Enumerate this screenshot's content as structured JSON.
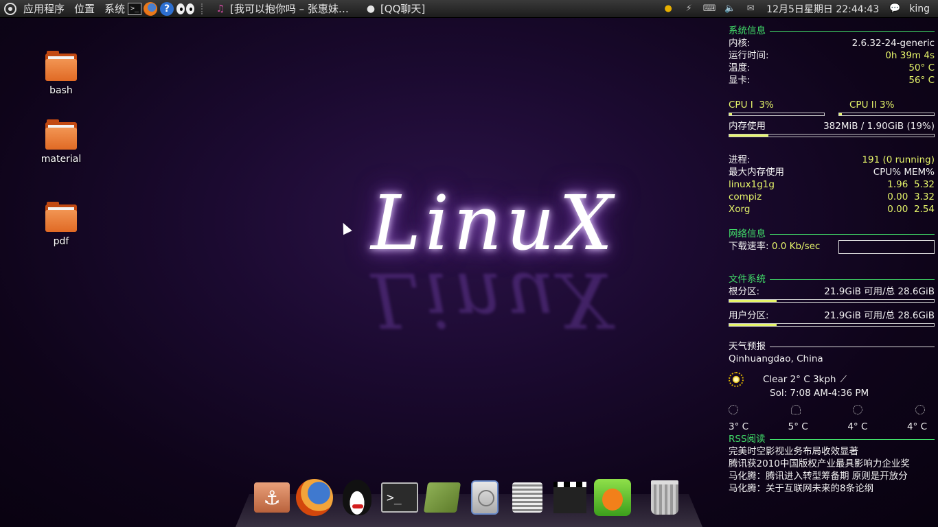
{
  "panel": {
    "menus": [
      "应用程序",
      "位置",
      "系统"
    ],
    "tasks": [
      {
        "label": "[我可以抱你吗 – 张惠妹…",
        "icon": "music-note-icon"
      },
      {
        "label": "[QQ聊天]",
        "icon": "qq-penguin-icon"
      }
    ],
    "clock": "12月5日星期日 22:44:43",
    "user": "king"
  },
  "desktop": {
    "icons": [
      {
        "label": "bash"
      },
      {
        "label": "material"
      },
      {
        "label": "pdf"
      }
    ],
    "wallpaper_text": "LinuX"
  },
  "conky": {
    "sysinfo": {
      "title": "系统信息",
      "rows": [
        {
          "label": "内核:",
          "value": "2.6.32-24-generic"
        },
        {
          "label": "运行时间:",
          "value": "0h 39m 4s"
        },
        {
          "label": "温度:",
          "value": "50° C"
        },
        {
          "label": "显卡:",
          "value": "56° C"
        }
      ]
    },
    "cpu": {
      "cpu1_label": "CPU I",
      "cpu1_value": "3%",
      "cpu2_label": "CPU II",
      "cpu2_value": "3%",
      "cpu1_level": 0.03,
      "cpu2_level": 0.03
    },
    "memory": {
      "label": "内存使用",
      "value": "382MiB / 1.90GiB (19%)",
      "level": 0.19
    },
    "processes": {
      "label": "进程:",
      "value": "191 (0 running)",
      "top_label": "最大内存使用",
      "top_header": "CPU% MEM%",
      "rows": [
        {
          "name": "linux1g1g",
          "cpu": "1.96",
          "mem": "5.32"
        },
        {
          "name": "compiz",
          "cpu": "0.00",
          "mem": "3.32"
        },
        {
          "name": "Xorg",
          "cpu": "0.00",
          "mem": "2.54"
        }
      ]
    },
    "network": {
      "title": "网络信息",
      "label": "下载速率:",
      "value": "0.0 Kb/sec"
    },
    "filesystem": {
      "title": "文件系统",
      "root_label": "根分区:",
      "root_value": "21.9GiB 可用/总 28.6GiB",
      "root_level": 0.23,
      "user_label": "用户分区:",
      "user_value": "21.9GiB 可用/总 28.6GiB",
      "user_level": 0.23
    },
    "weather": {
      "title": "天气预报",
      "location": "Qinhuangdao, China",
      "current": "Clear  2° C  3kph",
      "sol": "Sol: 7:08 AM-4:36 PM",
      "forecast": [
        "3° C",
        "5° C",
        "4° C",
        "4° C"
      ]
    },
    "rss": {
      "title": "RSS阅读",
      "items": [
        "完美时空影视业务布局收效显著",
        "腾讯获2010中国版权产业最具影响力企业奖",
        "马化腾：腾讯进入转型筹备期 原则是开放分",
        "马化腾：关于互联网未来的8条论纲"
      ]
    }
  }
}
